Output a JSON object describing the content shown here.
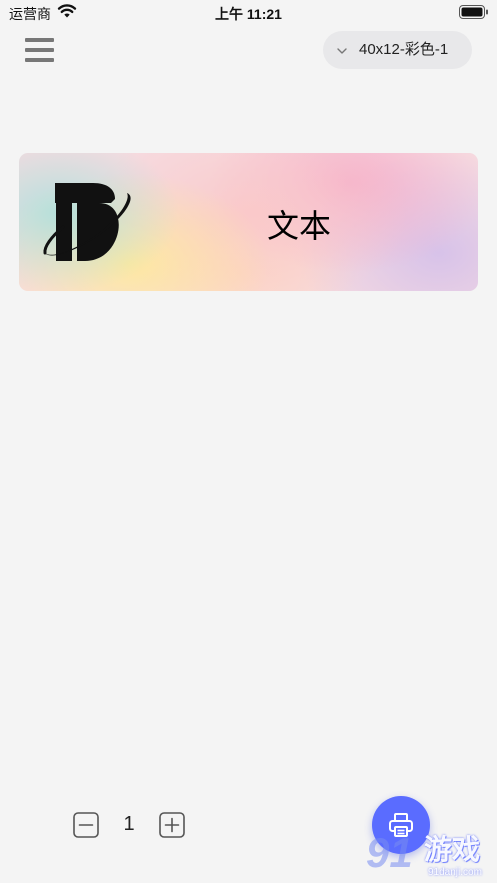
{
  "status_bar": {
    "carrier": "运营商",
    "time": "上午 11:21",
    "wifi_icon": "wifi-icon",
    "battery_icon": "battery-icon",
    "battery_level": 1.0
  },
  "header": {
    "menu_icon": "hamburger-menu-icon",
    "template_selector": {
      "value": "40x12-彩色-1",
      "icon": "chevron-down-icon"
    }
  },
  "label_preview": {
    "logo_icon": "brand-logo-icon",
    "text": "文本",
    "background": "watercolor pastel"
  },
  "quantity": {
    "value": "1",
    "minus_icon": "minus-square-icon",
    "plus_icon": "plus-square-icon"
  },
  "print_button": {
    "icon": "printer-icon",
    "color": "#5a6cff"
  },
  "watermark": {
    "number": "91",
    "text": "游戏",
    "url": "91danji.com"
  },
  "colors": {
    "background": "#f4f4f4",
    "accent": "#5a6cff",
    "selector_bg": "#e8e8ea",
    "icon_gray": "#777777"
  }
}
